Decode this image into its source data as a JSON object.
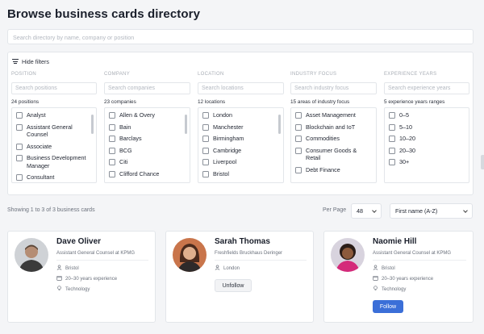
{
  "page": {
    "title": "Browse business cards directory"
  },
  "search": {
    "placeholder": "Search directory by name, company or position"
  },
  "filters": {
    "toggle_label": "Hide filters",
    "columns": [
      {
        "title": "POSITION",
        "placeholder": "Search positions",
        "count": "24 positions",
        "options": [
          "Analyst",
          "Assistant General Counsel",
          "Associate",
          "Business Development Manager",
          "Consultant"
        ]
      },
      {
        "title": "COMPANY",
        "placeholder": "Search companies",
        "count": "23 companies",
        "options": [
          "Allen & Overy",
          "Bain",
          "Barclays",
          "BCG",
          "Citi",
          "Clifford Chance"
        ]
      },
      {
        "title": "LOCATION",
        "placeholder": "Search locations",
        "count": "12 locations",
        "options": [
          "London",
          "Manchester",
          "Birmingham",
          "Cambridge",
          "Liverpool",
          "Bristol"
        ]
      },
      {
        "title": "INDUSTRY FOCUS",
        "placeholder": "Search industry focus",
        "count": "15 areas of industry focus",
        "options": [
          "Asset Management",
          "Blockchain and IoT",
          "Commodities",
          "Consumer Goods & Retail",
          "Debt Finance"
        ]
      },
      {
        "title": "EXPERIENCE YEARS",
        "placeholder": "Search experience years",
        "count": "5 experience years ranges",
        "options": [
          "0–5",
          "5–10",
          "10–20",
          "20–30",
          "30+"
        ]
      }
    ]
  },
  "results": {
    "summary": "Showing 1 to 3 of 3 business cards",
    "per_page_label": "Per Page",
    "per_page_value": "48",
    "sort_value": "First name (A-Z)"
  },
  "cards": [
    {
      "name": "Dave Oliver",
      "subtitle": "Assistant General Counsel at KPMG",
      "location": "Bristol",
      "experience": "20–30 years experience",
      "industry": "Technology"
    },
    {
      "name": "Sarah Thomas",
      "subtitle": "Freshfields Bruckhaus Deringer",
      "location": "London",
      "button_label": "Unfollow"
    },
    {
      "name": "Naomie Hill",
      "subtitle": "Assistant General Counsel at KPMG",
      "location": "Bristol",
      "experience": "20–30 years experience",
      "industry": "Technology",
      "button_label": "Follow"
    }
  ],
  "colors": {
    "accent": "#3b6fd8",
    "background": "#f4f5f7"
  }
}
